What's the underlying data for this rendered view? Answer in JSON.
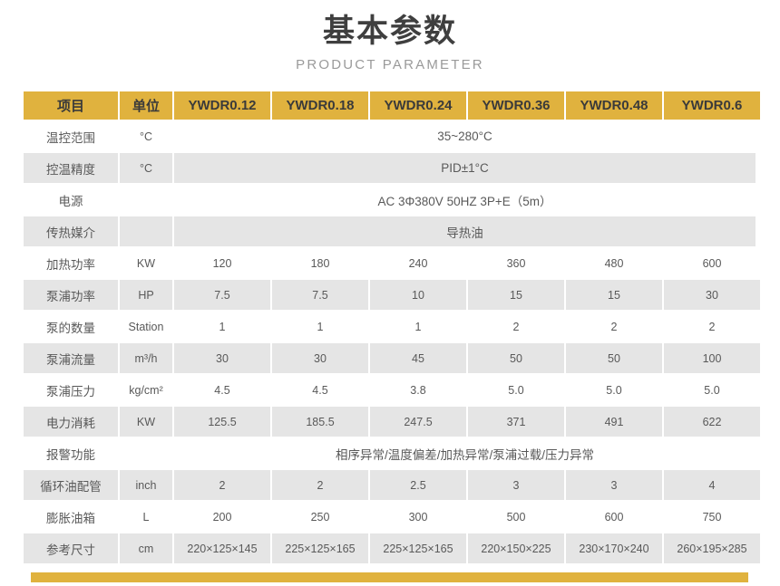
{
  "heading": {
    "title": "基本参数",
    "subtitle": "PRODUCT PARAMETER"
  },
  "colors": {
    "accent": "#e0b23e",
    "row_shade": "#e5e5e5",
    "row_plain": "#ffffff",
    "text": "#595959",
    "title_text": "#3f3f3f",
    "subtitle_text": "#9a9a9a"
  },
  "table": {
    "headers": [
      "项目",
      "单位",
      "YWDR0.12",
      "YWDR0.18",
      "YWDR0.24",
      "YWDR0.36",
      "YWDR0.48",
      "YWDR0.6"
    ],
    "rows": [
      {
        "item": "温控范围",
        "unit": "°C",
        "merged": true,
        "merged_value": "35~280°C",
        "values": []
      },
      {
        "item": "控温精度",
        "unit": "°C",
        "merged": true,
        "merged_value": "PID±1°C",
        "values": []
      },
      {
        "item": "电源",
        "unit": "",
        "merged": true,
        "merged_value": "AC 3Φ380V 50HZ 3P+E（5m）",
        "values": []
      },
      {
        "item": "传热媒介",
        "unit": "",
        "merged": true,
        "merged_value": "导热油",
        "values": []
      },
      {
        "item": "加热功率",
        "unit": "KW",
        "merged": false,
        "merged_value": "",
        "values": [
          "120",
          "180",
          "240",
          "360",
          "480",
          "600"
        ]
      },
      {
        "item": "泵浦功率",
        "unit": "HP",
        "merged": false,
        "merged_value": "",
        "values": [
          "7.5",
          "7.5",
          "10",
          "15",
          "15",
          "30"
        ]
      },
      {
        "item": "泵的数量",
        "unit": "Station",
        "merged": false,
        "merged_value": "",
        "values": [
          "1",
          "1",
          "1",
          "2",
          "2",
          "2"
        ]
      },
      {
        "item": "泵浦流量",
        "unit": "m³/h",
        "merged": false,
        "merged_value": "",
        "values": [
          "30",
          "30",
          "45",
          "50",
          "50",
          "100"
        ]
      },
      {
        "item": "泵浦压力",
        "unit": "kg/cm²",
        "merged": false,
        "merged_value": "",
        "values": [
          "4.5",
          "4.5",
          "3.8",
          "5.0",
          "5.0",
          "5.0"
        ]
      },
      {
        "item": "电力消耗",
        "unit": "KW",
        "merged": false,
        "merged_value": "",
        "values": [
          "125.5",
          "185.5",
          "247.5",
          "371",
          "491",
          "622"
        ]
      },
      {
        "item": "报警功能",
        "unit": "",
        "merged": true,
        "merged_value": "相序异常/温度偏差/加热异常/泵浦过载/压力异常",
        "values": []
      },
      {
        "item": "循环油配管",
        "unit": "inch",
        "merged": false,
        "merged_value": "",
        "values": [
          "2",
          "2",
          "2.5",
          "3",
          "3",
          "4"
        ]
      },
      {
        "item": "膨胀油箱",
        "unit": "L",
        "merged": false,
        "merged_value": "",
        "values": [
          "200",
          "250",
          "300",
          "500",
          "600",
          "750"
        ]
      },
      {
        "item": "参考尺寸",
        "unit": "cm",
        "merged": false,
        "merged_value": "",
        "values": [
          "220×125×145",
          "225×125×165",
          "225×125×165",
          "220×150×225",
          "230×170×240",
          "260×195×285"
        ]
      }
    ]
  }
}
